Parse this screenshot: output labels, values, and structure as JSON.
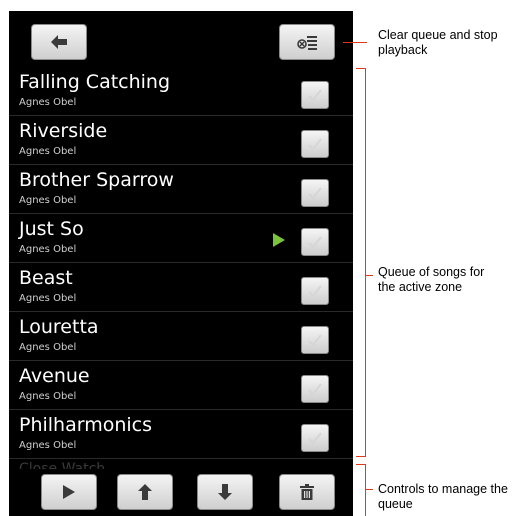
{
  "colors": {
    "background": "#000000",
    "accent_play": "#7bc43a",
    "annotation_line": "#e03a1a"
  },
  "toolbar": {
    "back_icon": "left-arrow-icon",
    "clear_icon": "clear-queue-icon"
  },
  "queue": {
    "songs": [
      {
        "title": "Falling Catching",
        "artist": "Agnes Obel",
        "playing": false
      },
      {
        "title": "Riverside",
        "artist": "Agnes Obel",
        "playing": false
      },
      {
        "title": "Brother Sparrow",
        "artist": "Agnes Obel",
        "playing": false
      },
      {
        "title": "Just So",
        "artist": "Agnes Obel",
        "playing": true
      },
      {
        "title": "Beast",
        "artist": "Agnes Obel",
        "playing": false
      },
      {
        "title": "Louretta",
        "artist": "Agnes Obel",
        "playing": false
      },
      {
        "title": "Avenue",
        "artist": "Agnes Obel",
        "playing": false
      },
      {
        "title": "Philharmonics",
        "artist": "Agnes Obel",
        "playing": false
      }
    ],
    "partial_next_title": "Close Watch"
  },
  "controls": {
    "play_icon": "play-icon",
    "up_icon": "up-arrow-icon",
    "down_icon": "down-arrow-icon",
    "delete_icon": "trash-icon"
  },
  "annotations": {
    "clear": "Clear queue and stop playback",
    "queue": "Queue of songs for the active zone",
    "controls": "Controls to manage the queue"
  }
}
